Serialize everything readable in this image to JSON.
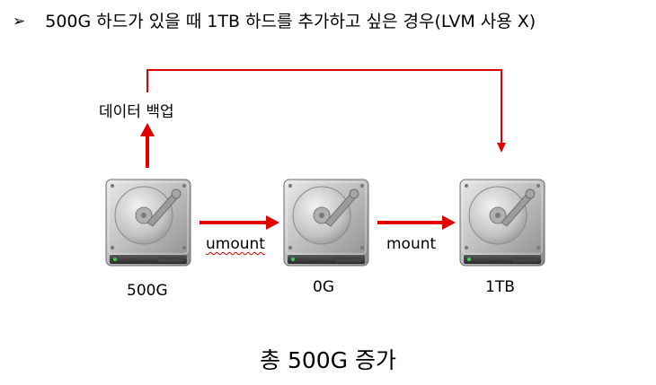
{
  "title": {
    "bullet": "➢",
    "text": "500G 하드가 있을 때 1TB 하드를 추가하고 싶은 경우(LVM 사용 X)"
  },
  "nodes": [
    {
      "id": "drive-500g",
      "label": "500G",
      "icon": "hard-drive-icon"
    },
    {
      "id": "drive-0g",
      "label": "0G",
      "icon": "hard-drive-icon"
    },
    {
      "id": "drive-1tb",
      "label": "1TB",
      "icon": "hard-drive-icon"
    }
  ],
  "edges": [
    {
      "from": "drive-500g",
      "to": "backup",
      "label": "데이터 백업"
    },
    {
      "from": "drive-500g",
      "to": "drive-0g",
      "label": "umount"
    },
    {
      "from": "drive-0g",
      "to": "drive-1tb",
      "label": "mount"
    },
    {
      "from": "backup",
      "to": "drive-1tb",
      "label": ""
    }
  ],
  "caption": "총 500G 증가",
  "colors": {
    "arrow": "#e00000",
    "wavy_underline": "#d00000"
  }
}
